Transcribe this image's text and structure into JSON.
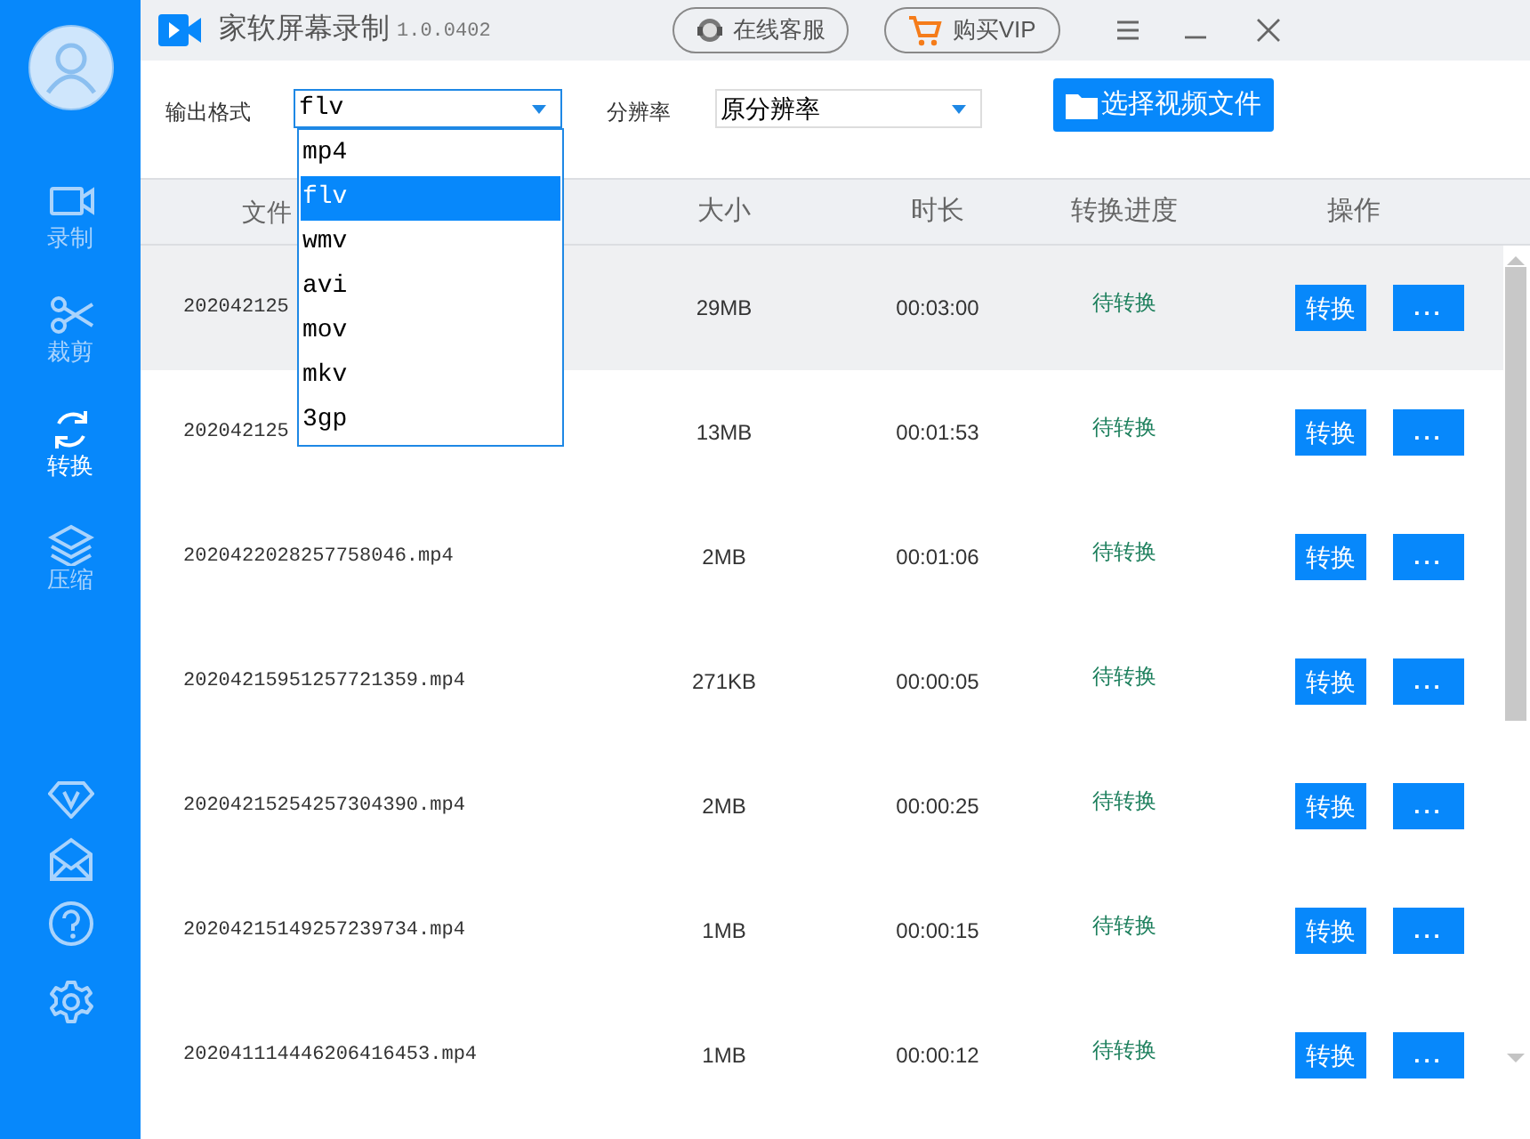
{
  "app": {
    "title": "家软屏幕录制",
    "version": "1.0.0402"
  },
  "title_buttons": [
    "在线客服",
    "购买VIP"
  ],
  "sidebar": {
    "items": [
      {
        "label": "录制",
        "kind": "record",
        "selected": false
      },
      {
        "label": "裁剪",
        "kind": "cut",
        "selected": false
      },
      {
        "label": "转换",
        "kind": "convert",
        "selected": true
      },
      {
        "label": "压缩",
        "kind": "compress",
        "selected": false
      }
    ]
  },
  "controls": {
    "format_label": "输出格式",
    "format_value": "flv",
    "resolution_label": "分辨率",
    "resolution_value": "原分辨率",
    "choose_button": "选择视频文件"
  },
  "format_dropdown": {
    "expanded": true,
    "options": [
      {
        "label": "mp4",
        "selected": false
      },
      {
        "label": "flv",
        "selected": true
      },
      {
        "label": "wmv",
        "selected": false
      },
      {
        "label": "avi",
        "selected": false
      },
      {
        "label": "mov",
        "selected": false
      },
      {
        "label": "mkv",
        "selected": false
      },
      {
        "label": "3gp",
        "selected": false
      }
    ]
  },
  "table": {
    "columns": [
      "文件",
      "大小",
      "时长",
      "转换进度",
      "操作"
    ],
    "rows": [
      {
        "file": "202042125",
        "size": "29MB",
        "duration": "00:03:00",
        "progress": "待转换",
        "action": "转换",
        "more": "...",
        "selected": true
      },
      {
        "file": "202042125",
        "size": "13MB",
        "duration": "00:01:53",
        "progress": "待转换",
        "action": "转换",
        "more": "...",
        "selected": false
      },
      {
        "file": "2020422028257758046.mp4",
        "size": "2MB",
        "duration": "00:01:06",
        "progress": "待转换",
        "action": "转换",
        "more": "...",
        "selected": false
      },
      {
        "file": "20204215951257721359.mp4",
        "size": "271KB",
        "duration": "00:00:05",
        "progress": "待转换",
        "action": "转换",
        "more": "...",
        "selected": false
      },
      {
        "file": "20204215254257304390.mp4",
        "size": "2MB",
        "duration": "00:00:25",
        "progress": "待转换",
        "action": "转换",
        "more": "...",
        "selected": false
      },
      {
        "file": "20204215149257239734.mp4",
        "size": "1MB",
        "duration": "00:00:15",
        "progress": "待转换",
        "action": "转换",
        "more": "...",
        "selected": false
      },
      {
        "file": "202041114446206416453.mp4",
        "size": "1MB",
        "duration": "00:00:12",
        "progress": "待转换",
        "action": "转换",
        "more": "...",
        "selected": false
      }
    ]
  }
}
